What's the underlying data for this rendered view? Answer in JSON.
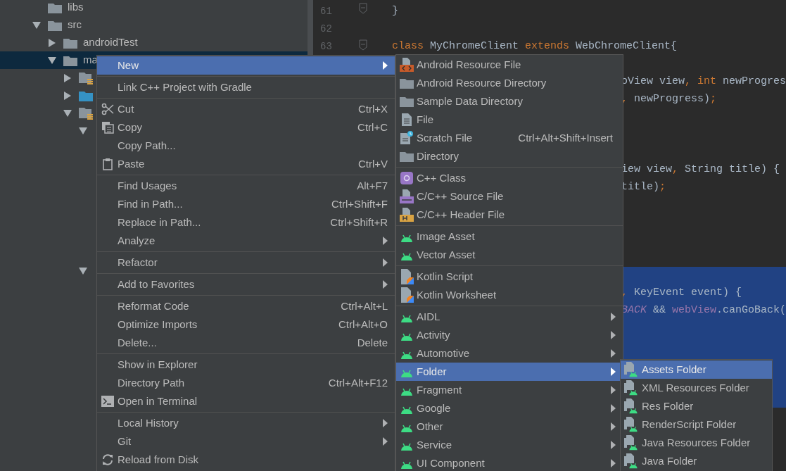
{
  "project_tree": [
    {
      "label": "libs",
      "kind": "folder"
    },
    {
      "label": "src",
      "kind": "folder",
      "expanded": true,
      "children": [
        {
          "label": "androidTest",
          "kind": "folder",
          "expanded": false
        },
        {
          "label": "ma",
          "kind": "folder",
          "expanded": true,
          "selected": true,
          "children": [
            {
              "kind": "res-folder",
              "expanded": false
            },
            {
              "kind": "source-folder",
              "expanded": false
            },
            {
              "kind": "res-folder",
              "expanded": true,
              "children": [
                {
                  "expanded": true
                },
                {
                  "expanded": true
                }
              ]
            }
          ]
        }
      ]
    }
  ],
  "editor": {
    "line_numbers": [
      "61",
      "62",
      "63"
    ],
    "lines": [
      {
        "segments": [
          {
            "text": "}",
            "kind": "plain"
          }
        ]
      },
      {
        "selected": false
      },
      {
        "segments": [
          {
            "text": "class ",
            "kind": "keyword"
          },
          {
            "text": "MyChromeClient ",
            "kind": "plain"
          },
          {
            "text": "extends ",
            "kind": "keyword"
          },
          {
            "text": "WebChromeClient{",
            "kind": "plain"
          }
        ]
      },
      {
        "selected": false
      },
      {
        "clipped": true,
        "segments": [
          {
            "text": "oView view",
            "kind": "plain"
          },
          {
            "text": ", ",
            "kind": "keyword"
          },
          {
            "text": "int ",
            "kind": "keyword"
          },
          {
            "text": "newProgres",
            "kind": "plain"
          }
        ]
      },
      {
        "clipped": true,
        "segments": [
          {
            "text": ", ",
            "kind": "keyword"
          },
          {
            "text": "newProgress)",
            "kind": "plain"
          },
          {
            "text": ";",
            "kind": "keyword"
          }
        ]
      },
      {
        "selected": false
      },
      {
        "selected": false
      },
      {
        "selected": false
      },
      {
        "clipped": true,
        "segments": [
          {
            "text": "iew view",
            "kind": "plain"
          },
          {
            "text": ", ",
            "kind": "keyword"
          },
          {
            "text": "String title) {",
            "kind": "plain"
          }
        ]
      },
      {
        "clipped": true,
        "segments": [
          {
            "text": "title)",
            "kind": "plain"
          },
          {
            "text": ";",
            "kind": "keyword"
          }
        ]
      },
      {
        "selected": false
      },
      {
        "selected": false
      },
      {
        "selected": false
      },
      {
        "selected": false
      },
      {
        "selected": true
      },
      {
        "selected": true,
        "clipped": true,
        "segments": [
          {
            "text": ", ",
            "kind": "keyword"
          },
          {
            "text": "KeyEvent event) {",
            "kind": "plain"
          }
        ]
      },
      {
        "selected": true,
        "clipped": true,
        "segments": [
          {
            "text": "BACK ",
            "kind": "constant"
          },
          {
            "text": "&& ",
            "kind": "plain"
          },
          {
            "text": "webView",
            "kind": "field"
          },
          {
            "text": ".canGoBack(",
            "kind": "plain"
          }
        ]
      },
      {
        "selected": true
      },
      {
        "selected": true
      },
      {
        "selected": true
      },
      {
        "selected": true
      },
      {
        "selected": true
      }
    ]
  },
  "context_menu": {
    "groups": [
      [
        {
          "label": "New",
          "submenu": true,
          "selected": true
        }
      ],
      [
        {
          "label": "Link C++ Project with Gradle",
          "selected": false
        }
      ],
      [
        {
          "label": "Cut",
          "shortcut": "Ctrl+X",
          "kind": "scissors",
          "selected": false
        },
        {
          "label": "Copy",
          "shortcut": "Ctrl+C",
          "kind": "copy",
          "selected": false
        },
        {
          "label": "Copy Path...",
          "selected": false
        },
        {
          "label": "Paste",
          "shortcut": "Ctrl+V",
          "kind": "clipboard",
          "selected": false
        }
      ],
      [
        {
          "label": "Find Usages",
          "shortcut": "Alt+F7",
          "selected": false
        },
        {
          "label": "Find in Path...",
          "shortcut": "Ctrl+Shift+F",
          "selected": false
        },
        {
          "label": "Replace in Path...",
          "shortcut": "Ctrl+Shift+R",
          "selected": false
        },
        {
          "label": "Analyze",
          "submenu": true,
          "selected": false
        }
      ],
      [
        {
          "label": "Refactor",
          "submenu": true,
          "selected": false
        }
      ],
      [
        {
          "label": "Add to Favorites",
          "submenu": true,
          "selected": false
        }
      ],
      [
        {
          "label": "Reformat Code",
          "shortcut": "Ctrl+Alt+L",
          "selected": false
        },
        {
          "label": "Optimize Imports",
          "shortcut": "Ctrl+Alt+O",
          "selected": false
        },
        {
          "label": "Delete...",
          "shortcut": "Delete",
          "selected": false
        }
      ],
      [
        {
          "label": "Show in Explorer",
          "selected": false
        },
        {
          "label": "Directory Path",
          "shortcut": "Ctrl+Alt+F12",
          "selected": false
        },
        {
          "label": "Open in Terminal",
          "kind": "terminal",
          "selected": false
        }
      ],
      [
        {
          "label": "Local History",
          "submenu": true,
          "selected": false
        },
        {
          "label": "Git",
          "submenu": true,
          "selected": false
        },
        {
          "label": "Reload from Disk",
          "kind": "reload",
          "selected": false
        }
      ]
    ]
  },
  "new_submenu": {
    "groups": [
      [
        {
          "label": "Android Resource File",
          "kind": "resource-file",
          "selected": false
        },
        {
          "label": "Android Resource Directory",
          "kind": "folder",
          "selected": false
        },
        {
          "label": "Sample Data Directory",
          "kind": "folder",
          "selected": false
        },
        {
          "label": "File",
          "kind": "file",
          "selected": false
        },
        {
          "label": "Scratch File",
          "shortcut": "Ctrl+Alt+Shift+Insert",
          "kind": "scratch",
          "selected": false
        },
        {
          "label": "Directory",
          "kind": "folder",
          "selected": false
        }
      ],
      [
        {
          "label": "C++ Class",
          "kind": "class",
          "selected": false
        },
        {
          "label": "C/C++ Source File",
          "kind": "cpp-file",
          "selected": false
        },
        {
          "label": "C/C++ Header File",
          "kind": "header-file",
          "selected": false
        }
      ],
      [
        {
          "label": "Image Asset",
          "kind": "android",
          "selected": false
        },
        {
          "label": "Vector Asset",
          "kind": "android",
          "selected": false
        }
      ],
      [
        {
          "label": "Kotlin Script",
          "kind": "kotlin",
          "selected": false
        },
        {
          "label": "Kotlin Worksheet",
          "kind": "kotlin",
          "selected": false
        }
      ],
      [
        {
          "label": "AIDL",
          "kind": "android",
          "submenu": true,
          "selected": false
        },
        {
          "label": "Activity",
          "kind": "android",
          "submenu": true,
          "selected": false
        },
        {
          "label": "Automotive",
          "kind": "android",
          "submenu": true,
          "selected": false
        },
        {
          "label": "Folder",
          "kind": "android",
          "submenu": true,
          "selected": true
        },
        {
          "label": "Fragment",
          "kind": "android",
          "submenu": true,
          "selected": false
        },
        {
          "label": "Google",
          "kind": "android",
          "submenu": true,
          "selected": false
        },
        {
          "label": "Other",
          "kind": "android",
          "submenu": true,
          "selected": false
        },
        {
          "label": "Service",
          "kind": "android",
          "submenu": true,
          "selected": false
        },
        {
          "label": "UI Component",
          "kind": "android",
          "submenu": true,
          "selected": false
        }
      ]
    ]
  },
  "folder_submenu": {
    "groups": [
      [
        {
          "label": "Assets Folder",
          "kind": "android-folder",
          "selected": true
        },
        {
          "label": "XML Resources Folder",
          "kind": "android-folder",
          "selected": false
        },
        {
          "label": "Res Folder",
          "kind": "android-folder",
          "selected": false
        },
        {
          "label": "RenderScript Folder",
          "kind": "android-folder",
          "selected": false
        },
        {
          "label": "Java Resources Folder",
          "kind": "android-folder",
          "selected": false
        },
        {
          "label": "Java Folder",
          "kind": "android-folder",
          "selected": false
        }
      ]
    ]
  }
}
